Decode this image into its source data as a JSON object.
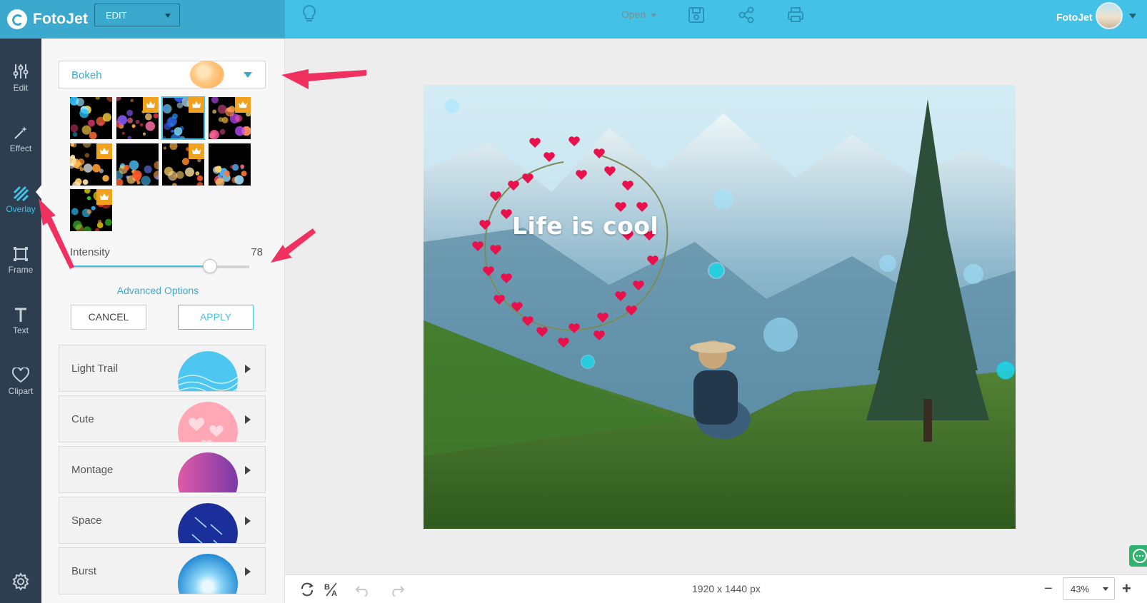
{
  "app": {
    "name": "FotoJet",
    "mode": "EDIT"
  },
  "topbar": {
    "open_label": "Open",
    "user": "FotoJet"
  },
  "rail": [
    {
      "label": "Edit",
      "icon": "sliders-icon"
    },
    {
      "label": "Effect",
      "icon": "magic-wand-icon"
    },
    {
      "label": "Overlay",
      "icon": "overlay-stripes-icon",
      "active": true
    },
    {
      "label": "Frame",
      "icon": "frame-icon"
    },
    {
      "label": "Text",
      "icon": "text-icon"
    },
    {
      "label": "Clipart",
      "icon": "heart-icon"
    }
  ],
  "overlay": {
    "selected_category": "Bokeh",
    "intensity_label": "Intensity",
    "intensity_value": "78",
    "intensity_fraction": 0.78,
    "advanced_label": "Advanced Options",
    "cancel_label": "CANCEL",
    "apply_label": "APPLY",
    "selected_thumbnail": 3,
    "premium_thumbnails": [
      2,
      3,
      4,
      5,
      7,
      9
    ]
  },
  "categories": [
    {
      "label": "Light Trail"
    },
    {
      "label": "Cute"
    },
    {
      "label": "Montage"
    },
    {
      "label": "Space"
    },
    {
      "label": "Burst"
    }
  ],
  "canvas": {
    "caption": "Life is cool"
  },
  "bottombar": {
    "dimensions": "1920 x 1440 px",
    "zoom": "43%"
  },
  "colors": {
    "accent": "#43c1e6",
    "rail": "#2c3e50",
    "arrow": "#f0305e",
    "premium": "#f0a21e"
  }
}
